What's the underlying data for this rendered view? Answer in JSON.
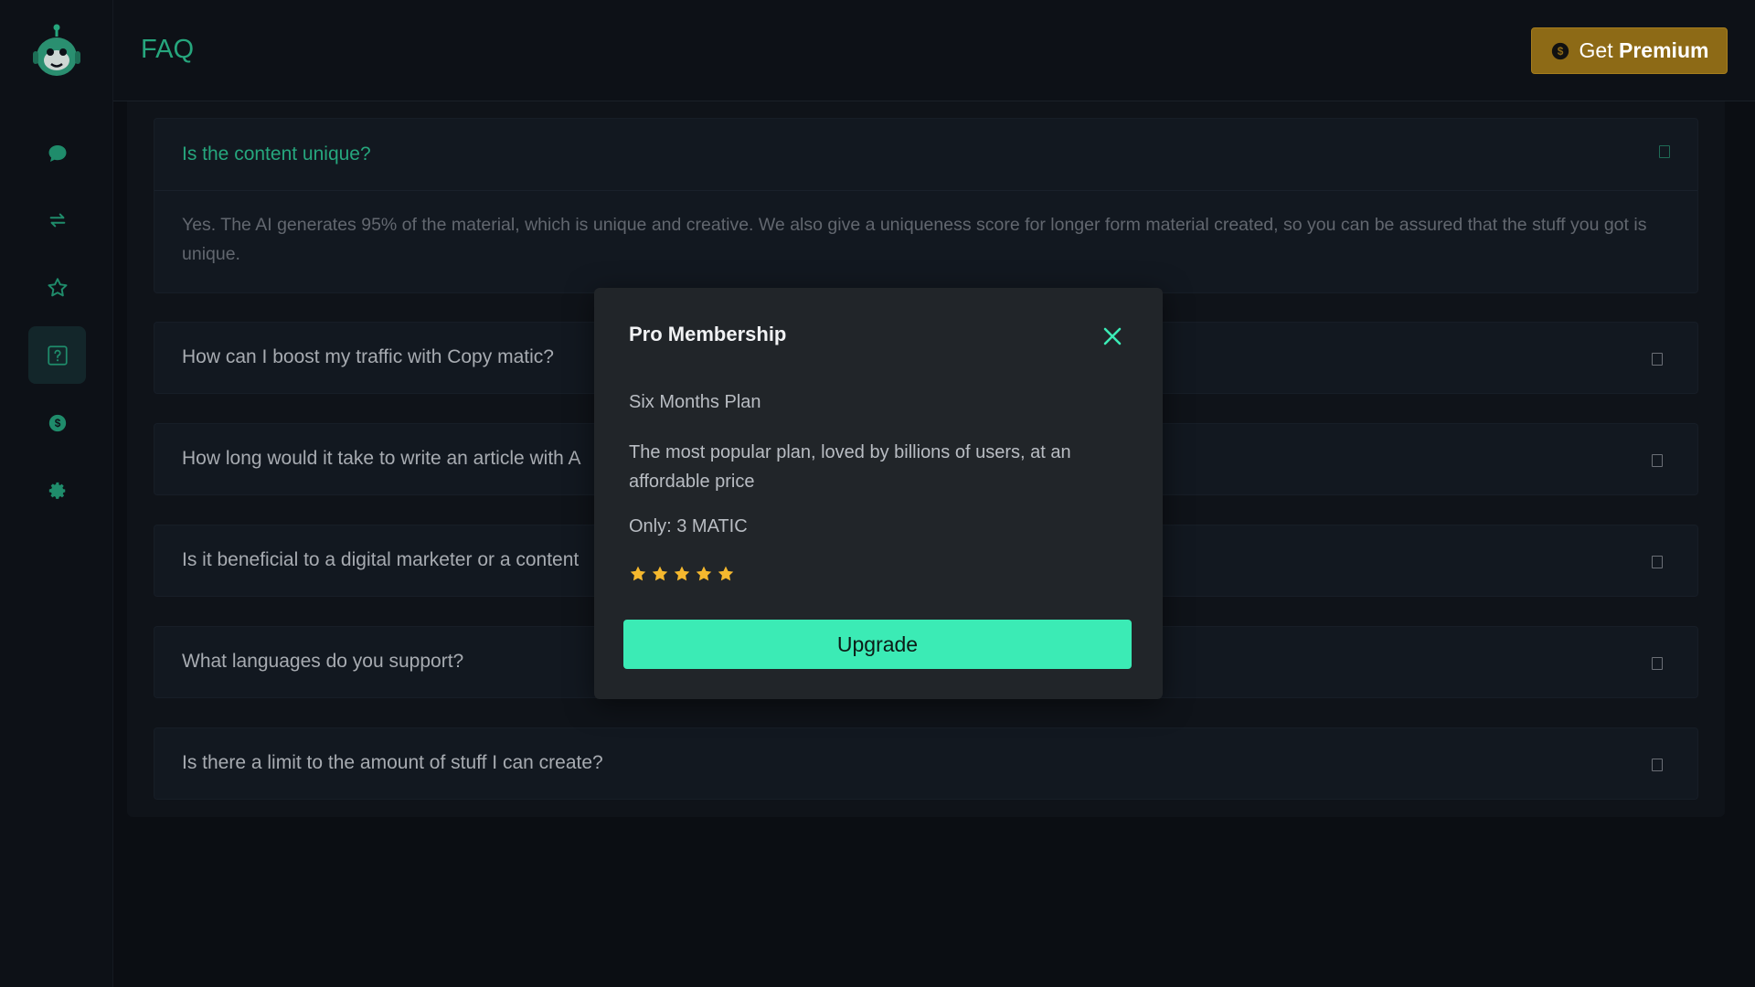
{
  "header": {
    "page_title": "FAQ",
    "premium_button": {
      "prefix": "Get",
      "strong": "Premium"
    }
  },
  "sidebar": {
    "items": [
      {
        "name": "chat",
        "icon": "chat-bubble-icon"
      },
      {
        "name": "swap",
        "icon": "swap-arrows-icon"
      },
      {
        "name": "favorites",
        "icon": "star-icon"
      },
      {
        "name": "faq",
        "icon": "question-icon",
        "active": true
      },
      {
        "name": "pricing",
        "icon": "dollar-icon"
      },
      {
        "name": "settings",
        "icon": "gear-icon"
      }
    ]
  },
  "faq": {
    "items": [
      {
        "question": "Is the content unique?",
        "open": true,
        "answer": "Yes. The AI generates 95% of the material, which is unique and creative. We also give a uniqueness score for longer form material created, so you can be assured that the stuff you got is unique."
      },
      {
        "question": "How can I boost my traffic with Copy matic?",
        "open": false
      },
      {
        "question": "How long would it take to write an article with A",
        "open": false
      },
      {
        "question": "Is it beneficial to a digital marketer or a content",
        "open": false
      },
      {
        "question": "What languages do you support?",
        "open": false
      },
      {
        "question": "Is there a limit to the amount of stuff I can create?",
        "open": false
      }
    ]
  },
  "modal": {
    "title": "Pro Membership",
    "plan": "Six Months Plan",
    "description": "The most popular plan, loved by billions of users, at an affordable price",
    "price": "Only: 3 MATIC",
    "rating": 5,
    "upgrade_label": "Upgrade"
  },
  "colors": {
    "accent": "#26a67d",
    "upgrade": "#3bebb5",
    "premium": "#8d6a16",
    "star": "#f5b82e"
  }
}
